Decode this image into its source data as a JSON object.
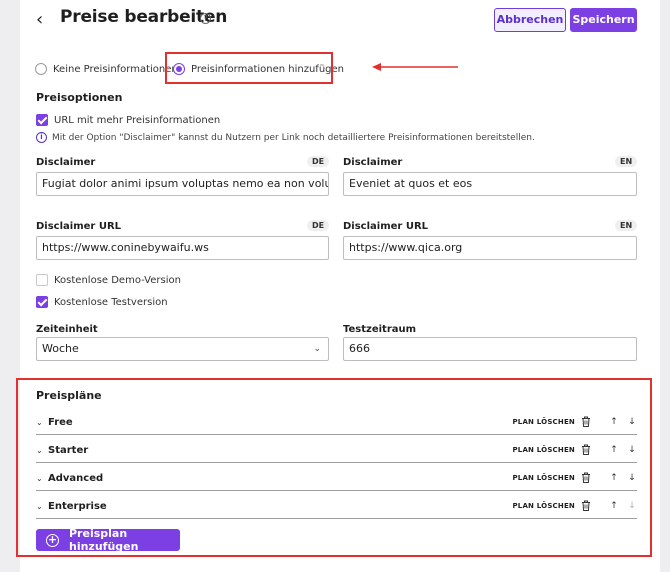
{
  "header": {
    "title": "Preise bearbeiten",
    "cancel_label": "Abbrechen",
    "save_label": "Speichern"
  },
  "pricing_mode": {
    "options": [
      {
        "label": "Keine Preisinformationen",
        "selected": false
      },
      {
        "label": "Preisinformationen hinzufügen",
        "selected": true
      }
    ]
  },
  "price_options": {
    "title": "Preisoptionen",
    "url_more_info": {
      "label": "URL mit mehr Preisinformationen",
      "checked": true
    },
    "info_text": "Mit der Option \"Disclaimer\" kannst du Nutzern per Link noch detailliertere Preisinformationen bereitstellen.",
    "disclaimer_de": {
      "label": "Disclaimer",
      "lang": "DE",
      "value": "Fugiat dolor animi ipsum voluptas nemo ea non voluptas v"
    },
    "disclaimer_en": {
      "label": "Disclaimer",
      "lang": "EN",
      "value": "Eveniet at quos et eos"
    },
    "disclaimer_url_de": {
      "label": "Disclaimer URL",
      "lang": "DE",
      "value": "https://www.coninebywaifu.ws"
    },
    "disclaimer_url_en": {
      "label": "Disclaimer URL",
      "lang": "EN",
      "value": "https://www.qica.org"
    },
    "free_demo": {
      "label": "Kostenlose Demo-Version",
      "checked": false
    },
    "free_trial": {
      "label": "Kostenlose Testversion",
      "checked": true
    },
    "time_unit": {
      "label": "Zeiteinheit",
      "value": "Woche"
    },
    "trial_period": {
      "label": "Testzeitraum",
      "value": "666"
    }
  },
  "plans": {
    "title": "Preispläne",
    "delete_label": "PLAN LÖSCHEN",
    "items": [
      {
        "name": "Free"
      },
      {
        "name": "Starter"
      },
      {
        "name": "Advanced"
      },
      {
        "name": "Enterprise"
      }
    ],
    "add_label": "Preisplan hinzufügen"
  },
  "colors": {
    "accent": "#7b3fe4",
    "highlight": "#e0302f"
  }
}
